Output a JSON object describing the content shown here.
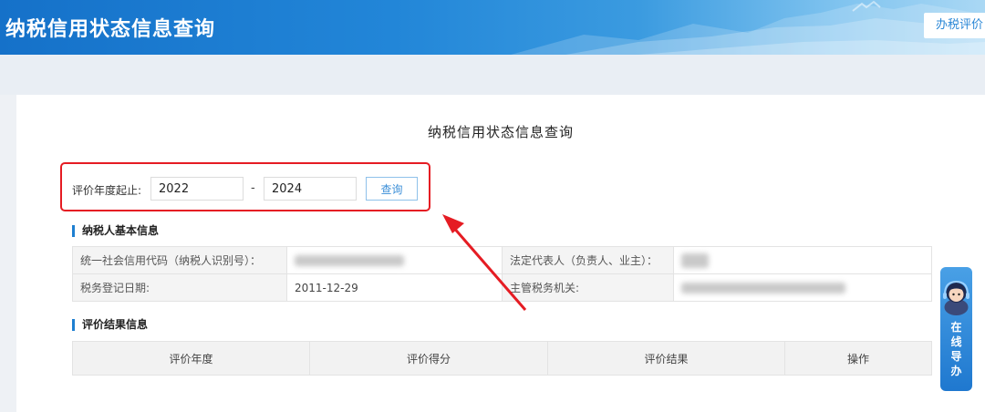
{
  "header": {
    "title": "纳税信用状态信息查询",
    "right_button": "办税评价",
    "colors": {
      "start": "#1571c9",
      "end": "#aad8f4"
    }
  },
  "page": {
    "title": "纳税信用状态信息查询"
  },
  "search": {
    "label": "评价年度起止:",
    "start_year": "2022",
    "separator": "-",
    "end_year": "2024",
    "button": "查询",
    "highlight_color": "#e51c23"
  },
  "taxpayer": {
    "section_title": "纳税人基本信息",
    "rows": [
      {
        "label1": "统一社会信用代码（纳税人识别号）：",
        "value1": "",
        "label2": "法定代表人（负责人、业主）：",
        "value2": ""
      },
      {
        "label1": "税务登记日期:",
        "value1": "2011-12-29",
        "label2": "主管税务机关:",
        "value2": ""
      }
    ]
  },
  "result": {
    "section_title": "评价结果信息",
    "columns": [
      "评价年度",
      "评价得分",
      "评价结果",
      "操作"
    ]
  },
  "side_widget": {
    "chars": [
      "在",
      "线",
      "导",
      "办"
    ],
    "icon": "customer-service-avatar-icon"
  },
  "accent_color": "#1e7fd1"
}
